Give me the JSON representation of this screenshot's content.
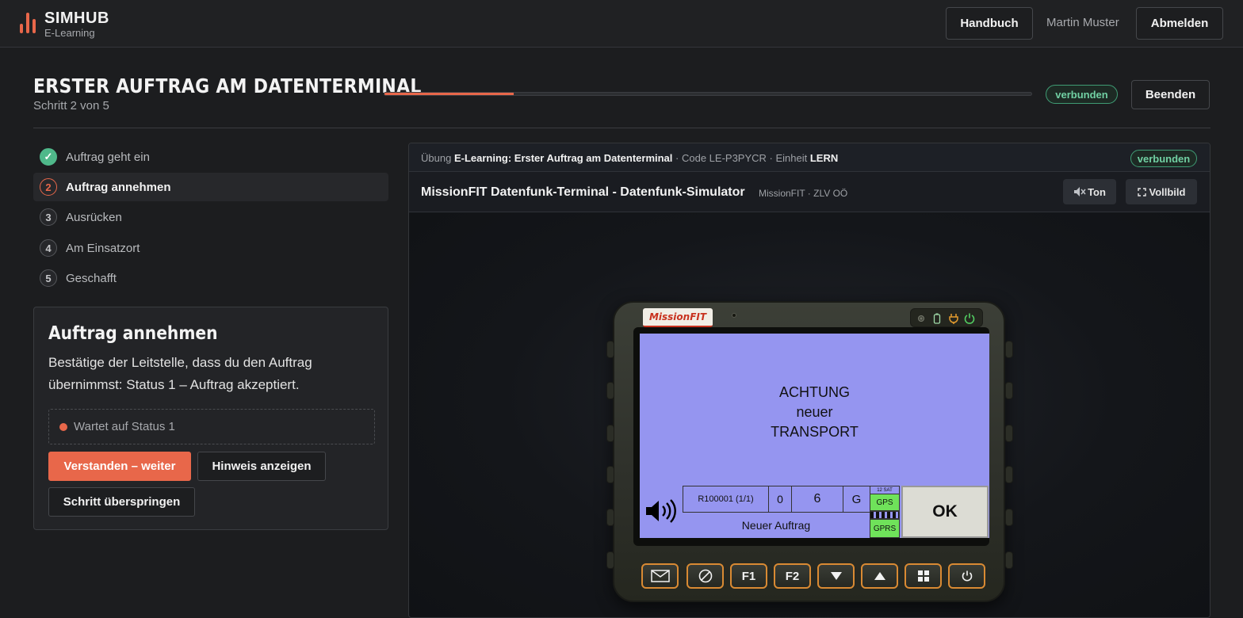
{
  "app": {
    "brand": "SIMHUB",
    "subtitle": "E-Learning",
    "accent": "#e8674a"
  },
  "topnav": {
    "manual_label": "Handbuch",
    "user": "Martin Muster",
    "logout_label": "Abmelden"
  },
  "header": {
    "title": "ERSTER AUFTRAG AM DATENTERMINAL",
    "step_text": "Schritt 2 von 5",
    "progress": 0.2,
    "status_badge": "verbunden",
    "end_label": "Beenden"
  },
  "steps": [
    {
      "num": "✓",
      "label": "Auftrag geht ein",
      "state": "done"
    },
    {
      "num": "2",
      "label": "Auftrag annehmen",
      "state": "active"
    },
    {
      "num": "3",
      "label": "Ausrücken",
      "state": "pending"
    },
    {
      "num": "4",
      "label": "Am Einsatzort",
      "state": "pending"
    },
    {
      "num": "5",
      "label": "Geschafft",
      "state": "pending"
    }
  ],
  "task": {
    "title": "Auftrag annehmen",
    "description": "Bestätige der Leitstelle, dass du den Auftrag übernimmst: Status 1 – Auftrag akzeptiert.",
    "wait_text": "Wartet auf Status 1",
    "continue_label": "Verstanden – weiter",
    "hint_label": "Hinweis anzeigen",
    "skip_label": "Schritt überspringen"
  },
  "simulator": {
    "exercise_prefix": "Übung",
    "exercise_name": "E-Learning: Erster Auftrag am Datenterminal",
    "code_text": "· Code LE-P3PYCR · Einheit",
    "unit": "LERN",
    "status_badge": "verbunden",
    "name": "MissionFIT Datenfunk-Terminal - Datenfunk-Simulator",
    "meta": "MissionFIT · ZLV OÖ",
    "sound_label": "Ton",
    "fullscreen_label": "Vollbild"
  },
  "device": {
    "logo": "MissionFIT",
    "message_lines": [
      "ACHTUNG",
      "neuer",
      "TRANSPORT"
    ],
    "order_id": "R100001 (1/1)",
    "field_a": "0",
    "field_b": "6",
    "field_c": "G",
    "sat_text": "12 SAT",
    "gps_label": "GPS",
    "gprs_label": "GPRS",
    "status_text": "Neuer Auftrag",
    "ok_label": "OK",
    "keys": [
      "mail-icon",
      "cancel-icon",
      "F1",
      "F2",
      "arrow-down-icon",
      "arrow-up-icon",
      "menu-grid-icon",
      "power-icon"
    ]
  }
}
